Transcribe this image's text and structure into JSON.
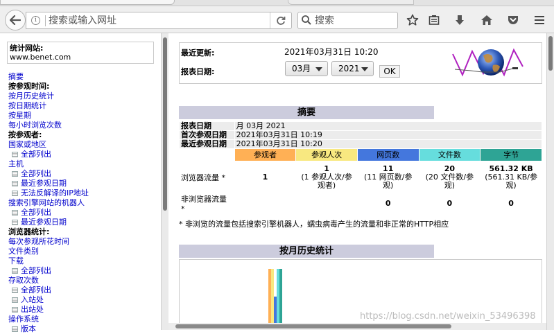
{
  "browser": {
    "url_placeholder": "搜索或输入网址",
    "search_placeholder": "搜索"
  },
  "sidebar": {
    "stat_site_label": "统计网站:",
    "stat_site_value": "www.benet.com",
    "nav": [
      {
        "type": "link",
        "label": "摘要"
      },
      {
        "type": "head",
        "label": "按参观时间:"
      },
      {
        "type": "link",
        "label": "按月历史统计"
      },
      {
        "type": "link",
        "label": "按日期统计"
      },
      {
        "type": "link",
        "label": "按星期"
      },
      {
        "type": "link",
        "label": "每小时浏览次数"
      },
      {
        "type": "head",
        "label": "按参观者:"
      },
      {
        "type": "link",
        "label": "国家或地区"
      },
      {
        "type": "sub",
        "label": "全部列出"
      },
      {
        "type": "link",
        "label": "主机"
      },
      {
        "type": "sub",
        "label": "全部列出"
      },
      {
        "type": "sub",
        "label": "最近参观日期"
      },
      {
        "type": "sub",
        "label": "无法反解译的IP地址"
      },
      {
        "type": "link",
        "label": "搜索引擎网站的机器人"
      },
      {
        "type": "sub",
        "label": "全部列出"
      },
      {
        "type": "sub",
        "label": "最近参观日期"
      },
      {
        "type": "head",
        "label": "浏览器统计:"
      },
      {
        "type": "link",
        "label": "每次参观所花时间"
      },
      {
        "type": "link",
        "label": "文件类别"
      },
      {
        "type": "link",
        "label": "下载"
      },
      {
        "type": "sub",
        "label": "全部列出"
      },
      {
        "type": "link",
        "label": "存取次数"
      },
      {
        "type": "sub",
        "label": "全部列出"
      },
      {
        "type": "sub",
        "label": "入站处"
      },
      {
        "type": "sub",
        "label": "出站处"
      },
      {
        "type": "link",
        "label": "操作系统"
      },
      {
        "type": "sub",
        "label": "版本"
      }
    ]
  },
  "header": {
    "last_update_label": "最近更新:",
    "last_update_value": "2021年03月31日 10:20",
    "report_date_label": "报表日期:",
    "month_value": "03月",
    "year_value": "2021",
    "ok_label": "OK"
  },
  "summary": {
    "title": "摘要",
    "rows": [
      {
        "label": "报表日期",
        "value": "月 03月 2021"
      },
      {
        "label": "首次参观日期",
        "value": "2021年03月31日 10:19"
      },
      {
        "label": "最近参观日期",
        "value": "2021年03月31日 10:20"
      }
    ],
    "columns": [
      {
        "label": "参观者",
        "color": "#ffb055"
      },
      {
        "label": "参观人次",
        "color": "#f8e880"
      },
      {
        "label": "网页数",
        "color": "#4477dd"
      },
      {
        "label": "文件数",
        "color": "#66dddd"
      },
      {
        "label": "字节",
        "color": "#2ea495"
      }
    ],
    "browser_traffic": {
      "label": "浏览器流量 *",
      "visitors": "1",
      "visits": "1",
      "visits_detail": "(1 参观人次/参观者)",
      "pages": "11",
      "pages_detail": "(11 网页数/参观)",
      "files": "20",
      "files_detail": "(20 文件数/参观)",
      "bytes": "561.32 KB",
      "bytes_detail": "(561.31 KB/参观)"
    },
    "non_browser_traffic": {
      "label": "非浏览器流量 *",
      "pages": "0",
      "files": "0",
      "bytes": "0"
    },
    "note": "* 非浏览的流量包括搜索引擎机器人，蠕虫病毒产生的流量和非正常的HTTP相应"
  },
  "history": {
    "title": "按月历史统计"
  },
  "watermark": "https://blog.csdn.net/weixin_53496398"
}
